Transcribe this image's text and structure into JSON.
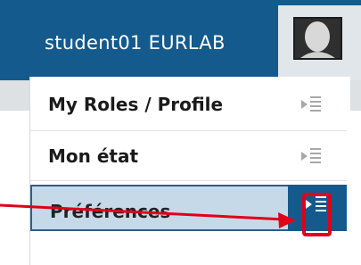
{
  "header": {
    "user_name": "student01 EURLAB"
  },
  "menu": {
    "items": [
      {
        "label": "My Roles / Profile"
      },
      {
        "label": "Mon état"
      },
      {
        "label": "Préférences"
      }
    ]
  },
  "colors": {
    "header_bg": "#145a8c",
    "highlight": "#e0001a",
    "active_bg": "#c6d9e8"
  },
  "icons": {
    "avatar": "user-avatar-icon",
    "submenu": "submenu-arrow-icon"
  }
}
